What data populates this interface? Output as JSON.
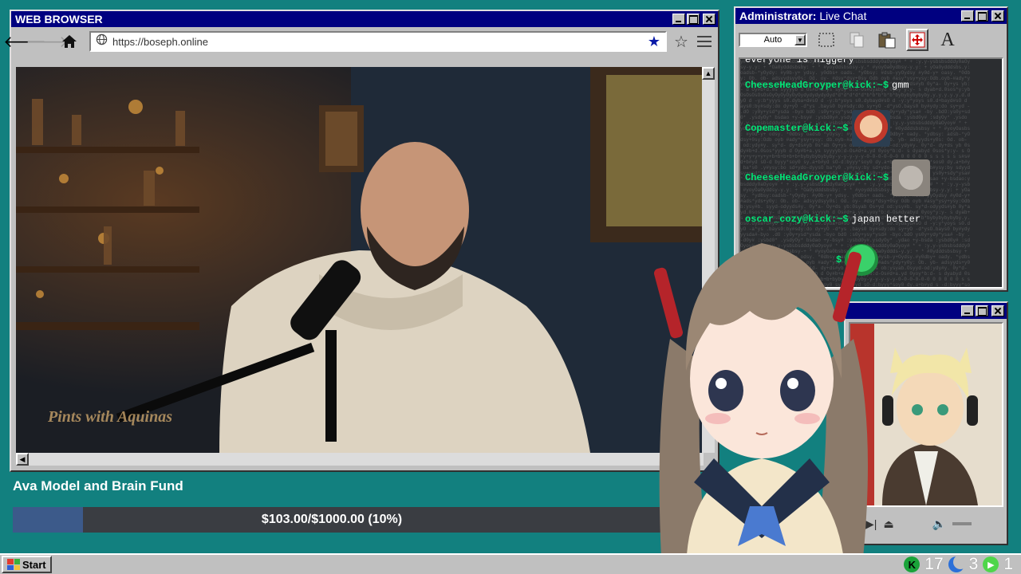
{
  "browser": {
    "title": "WEB BROWSER",
    "url": "https://boseph.online",
    "video_overlay_logo": "Pints with Aquinas"
  },
  "fund": {
    "title": "Ava Model and Brain Fund",
    "progress_text": "$103.00/$1000.00 (10%)",
    "progress": 0.1
  },
  "chat": {
    "title_prefix": "Administrator:",
    "title_suffix": " Live Chat",
    "select_value": "Auto",
    "tool_letter": "A",
    "partial_line": "everyone is niggery",
    "messages": [
      {
        "user": "CheeseHeadGroyper@kick:~$",
        "text": "gmm",
        "emote": null
      },
      {
        "user": "Copemaster@kick:~$",
        "text": "",
        "emote": "clown-face-emote"
      },
      {
        "user": "CheeseHeadGroyper@kick:~$",
        "text": "",
        "emote": "cat-emote"
      },
      {
        "user": "oscar_cozy@kick:~$",
        "text": "japan better",
        "emote": null
      },
      {
        "user": "",
        "text": "",
        "emote": "crying-pepe-emote"
      }
    ]
  },
  "taskbar": {
    "start_label": "Start",
    "tray": {
      "kick_icon": "K",
      "kick_count": "17",
      "moon_count": "3",
      "play_count": "1"
    }
  },
  "colors": {
    "desktop": "#12807f",
    "titlebar": "#000080",
    "chat_user": "#00e676",
    "fund_fill": "#3c5a8a"
  }
}
